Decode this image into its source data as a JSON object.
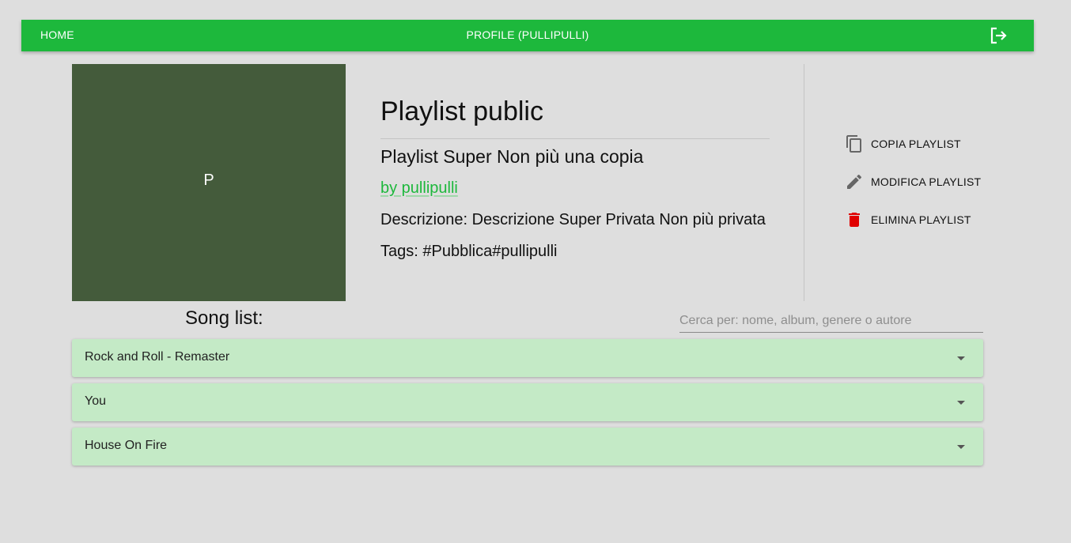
{
  "navbar": {
    "home_label": "HOME",
    "profile_label": "PROFILE (PULLIPULLI)",
    "logout_icon": "logout-icon",
    "color": "#1db83c"
  },
  "playlist": {
    "cover_letter": "P",
    "cover_color": "#445b3b",
    "title": "Playlist public",
    "name": "Playlist Super Non più una copia",
    "owner": "by pullipulli",
    "description": "Descrizione: Descrizione Super Privata Non più privata",
    "tags": "Tags: #Pubblica#pullipulli"
  },
  "actions": [
    {
      "label": "COPIA PLAYLIST",
      "icon": "copy-icon"
    },
    {
      "label": "MODIFICA PLAYLIST",
      "icon": "pencil-icon"
    },
    {
      "label": "ELIMINA PLAYLIST",
      "icon": "trash-icon",
      "color": "#e00000"
    }
  ],
  "songs": {
    "label": "Song list:",
    "search_placeholder": "Cerca per: nome, album, genere o autore",
    "items": [
      {
        "name": "Rock and Roll - Remaster"
      },
      {
        "name": "You"
      },
      {
        "name": "House On Fire"
      }
    ],
    "row_color": "#c4eac6"
  }
}
